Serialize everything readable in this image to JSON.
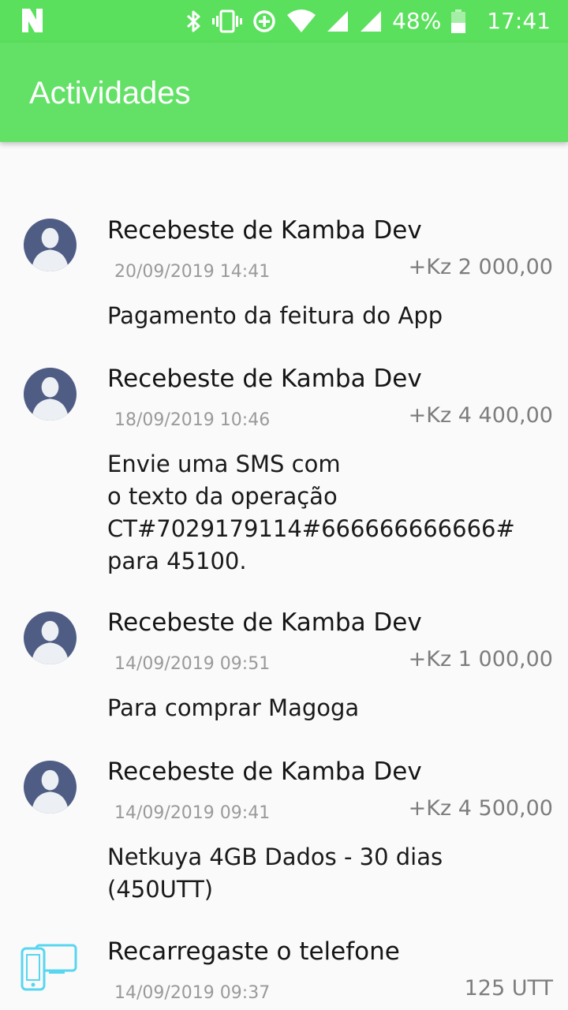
{
  "status_bar": {
    "battery": "48%",
    "time": "17:41",
    "icons": [
      "n-notification-icon",
      "bluetooth-icon",
      "vibrate-icon",
      "data-saver-icon",
      "wifi-icon",
      "signal-icon",
      "signal-icon",
      "battery-icon"
    ]
  },
  "app_bar": {
    "title": "Actividades"
  },
  "colors": {
    "status_bar": "#5ae05c",
    "app_bar": "#62e166",
    "avatar": "#4f5d85",
    "device_icon": "#58d6f0"
  },
  "activities": [
    {
      "icon": "user-avatar-icon",
      "title": "Recebeste de Kamba Dev",
      "date": "20/09/2019 14:41",
      "amount": "+Kz 2 000,00",
      "description": "Pagamento da feitura do App"
    },
    {
      "icon": "user-avatar-icon",
      "title": "Recebeste de Kamba Dev",
      "date": "18/09/2019 10:46",
      "amount": "+Kz 4 400,00",
      "description": "Envie uma SMS com\no texto da operação\nCT#7029179114#666666666666#\npara 45100."
    },
    {
      "icon": "user-avatar-icon",
      "title": "Recebeste de Kamba Dev",
      "date": "14/09/2019 09:51",
      "amount": "+Kz 1 000,00",
      "description": "Para comprar Magoga"
    },
    {
      "icon": "user-avatar-icon",
      "title": "Recebeste de Kamba Dev",
      "date": "14/09/2019 09:41",
      "amount": "+Kz 4 500,00",
      "description": "Netkuya 4GB Dados - 30 dias\n(450UTT)"
    },
    {
      "icon": "phone-devices-icon",
      "title": "Recarregaste o telefone",
      "date": "14/09/2019 09:37",
      "amount": "125 UTT",
      "description": ""
    }
  ]
}
